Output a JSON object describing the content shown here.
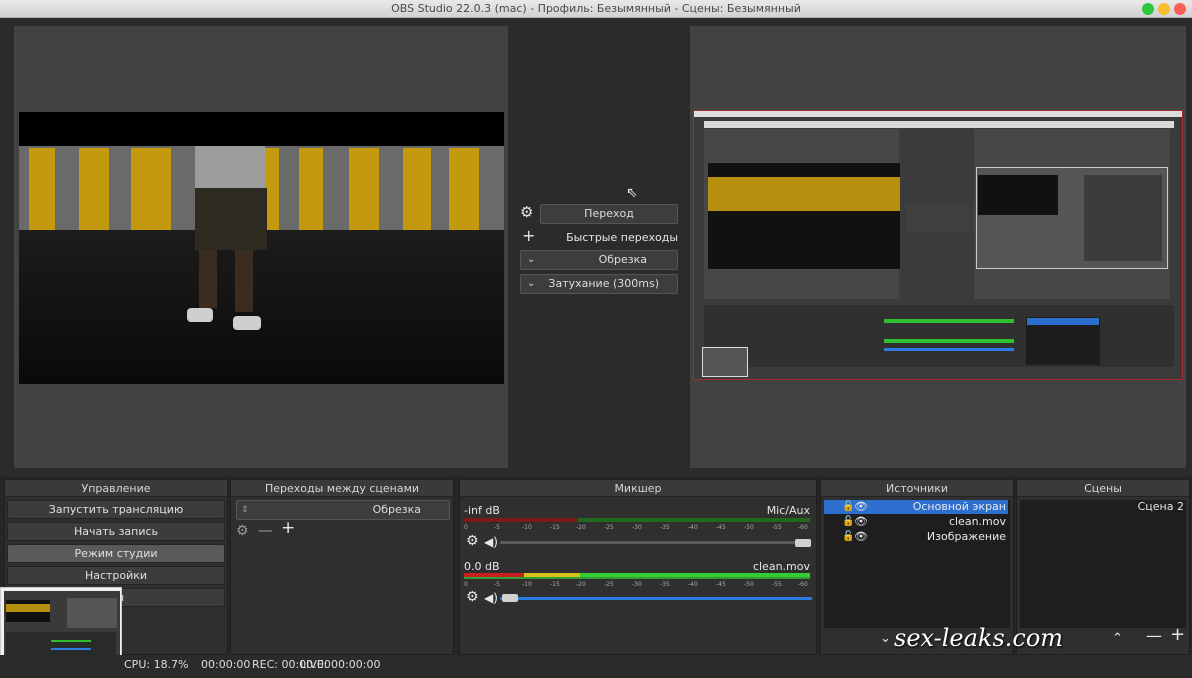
{
  "window": {
    "title": "OBS Studio 22.0.3 (mac) - Профиль: Безымянный - Сцены: Безымянный"
  },
  "transition": {
    "button": "Переход",
    "quick_label": "Быстрые переходы",
    "items": [
      "Обрезка",
      "Затухание (300ms)"
    ]
  },
  "docks": {
    "controls": {
      "title": "Управление",
      "buttons": [
        "Запустить трансляцию",
        "Начать запись",
        "Режим студии",
        "Настройки",
        "Вы"
      ],
      "active_index": 2
    },
    "transitions": {
      "title": "Переходы между сценами",
      "selected": "Обрезка"
    },
    "mixer": {
      "title": "Микшер",
      "channels": [
        {
          "name": "Mic/Aux",
          "level": "-inf dB",
          "volume": 1.0
        },
        {
          "name": "clean.mov",
          "level": "0.0 dB",
          "volume": 0.03
        }
      ],
      "ticks": [
        "-60",
        "-55",
        "-50",
        "-45",
        "-40",
        "-35",
        "-30",
        "-25",
        "-20",
        "-15",
        "-10",
        "-5",
        "0"
      ]
    },
    "sources": {
      "title": "Источники",
      "items": [
        "Основной экран",
        "clean.mov",
        "Изображение"
      ],
      "selected_index": 0
    },
    "scenes": {
      "title": "Сцены",
      "items": [
        "Сцена 2"
      ]
    }
  },
  "status": {
    "live": "LIVE: 00:00:00",
    "rec": "REC: 00:00:00",
    "cpu": "CPU: 18.7%",
    "time": "00:00:00"
  },
  "watermark": "sex-leaks.com",
  "colors": {
    "selection": "#2d6fcf",
    "meter_green": "#33cc33",
    "meter_yellow": "#d9c21d",
    "meter_red": "#c8201f",
    "volume_blue": "#2b7be0"
  }
}
